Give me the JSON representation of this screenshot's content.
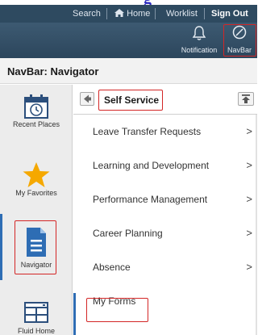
{
  "heading_fragment": "g",
  "topbar": {
    "search": "Search",
    "home": "Home",
    "worklist": "Worklist",
    "signout": "Sign Out"
  },
  "iconbar": {
    "notification": "Notification",
    "navbar": "NavBar"
  },
  "title": "NavBar: Navigator",
  "rail": {
    "recent": "Recent Places",
    "favorites": "My Favorites",
    "navigator": "Navigator",
    "fluid_home": "Fluid Home"
  },
  "panel": {
    "title": "Self Service",
    "items": [
      {
        "label": "Leave Transfer Requests",
        "chevron": ">"
      },
      {
        "label": "Learning and Development",
        "chevron": ">"
      },
      {
        "label": "Performance Management",
        "chevron": ">"
      },
      {
        "label": "Career Planning",
        "chevron": ">"
      },
      {
        "label": "Absence",
        "chevron": ">"
      },
      {
        "label": "My Forms",
        "chevron": ""
      }
    ]
  },
  "colors": {
    "header_dark": "#2e4a60",
    "accent_blue": "#2e6db4",
    "highlight_red": "#d32626",
    "favorite_star": "#f5a800"
  }
}
